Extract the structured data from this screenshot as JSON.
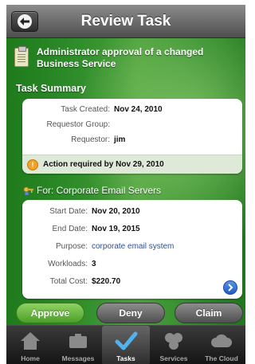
{
  "header": {
    "title": "Review Task",
    "back_icon": "back-arrow-icon"
  },
  "task": {
    "title": "Administrator approval of a changed Business Service"
  },
  "task_summary": {
    "heading": "Task Summary",
    "fields": [
      {
        "label": "Task Created:",
        "value": "Nov 24, 2010"
      },
      {
        "label": "Requestor Group:",
        "value": ""
      },
      {
        "label": "Requestor:",
        "value": "jim"
      }
    ],
    "action_text": "Action required by Nov 29, 2010"
  },
  "service": {
    "heading": "For: Corporate Email Servers",
    "fields": [
      {
        "label": "Start Date:",
        "value": "Nov 20, 2010"
      },
      {
        "label": "End Date:",
        "value": "Nov 19, 2015"
      },
      {
        "label": "Purpose:",
        "value": "corporate email system"
      },
      {
        "label": "Workloads:",
        "value": "3"
      },
      {
        "label": "Total Cost:",
        "value": "$220.70"
      }
    ]
  },
  "buttons": {
    "approve": "Approve",
    "deny": "Deny",
    "claim": "Claim"
  },
  "tabs": [
    {
      "label": "Home",
      "icon": "home-icon",
      "active": false
    },
    {
      "label": "Messages",
      "icon": "messages-icon",
      "active": false
    },
    {
      "label": "Tasks",
      "icon": "tasks-checkmark-icon",
      "active": true
    },
    {
      "label": "Services",
      "icon": "services-icon",
      "active": false
    },
    {
      "label": "The Cloud",
      "icon": "cloud-icon",
      "active": false
    }
  ],
  "colors": {
    "green_accent": "#3f9a33",
    "approve_button": "#6bbd43",
    "link": "#2b4f9a",
    "action_icon": "#f0a22a"
  }
}
